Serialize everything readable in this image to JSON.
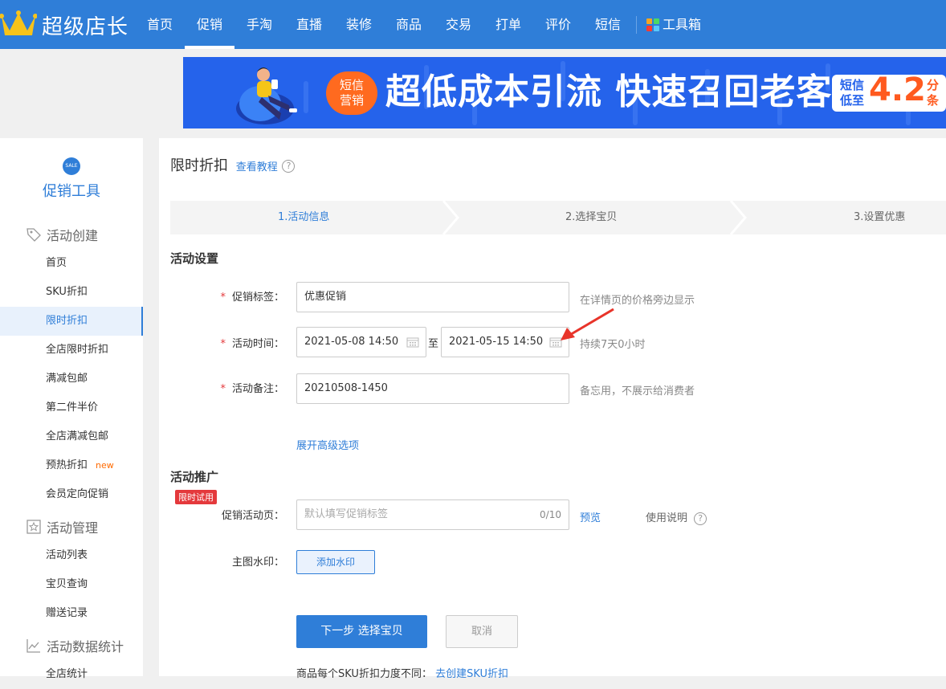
{
  "app": {
    "name": "超级店长"
  },
  "nav": {
    "items": [
      "首页",
      "促销",
      "手淘",
      "直播",
      "装修",
      "商品",
      "交易",
      "打单",
      "评价",
      "短信"
    ],
    "active": "促销",
    "toolbox": "工具箱"
  },
  "banner": {
    "badge_line1": "短信",
    "badge_line2": "营销",
    "title": "超低成本引流 快速召回老客",
    "price_label_1": "短信",
    "price_label_2": "低至",
    "price_value": "4.2",
    "price_unit_1": "分",
    "price_unit_2": "条"
  },
  "sidebar": {
    "sale_icon_text": "SALE",
    "title": "促销工具",
    "groups": [
      {
        "label": "活动创建",
        "icon": "tag-icon"
      },
      {
        "label": "活动管理",
        "icon": "star-icon"
      },
      {
        "label": "活动数据统计",
        "icon": "chart-icon"
      }
    ],
    "items": [
      "首页",
      "SKU折扣",
      "限时折扣",
      "全店限时折扣",
      "满减包邮",
      "第二件半价",
      "全店满减包邮",
      "预热折扣",
      "会员定向促销",
      "活动列表",
      "宝贝查询",
      "赠送记录",
      "全店统计"
    ],
    "active": "限时折扣",
    "new_badge": "new"
  },
  "page": {
    "title": "限时折扣",
    "tutorial_link": "查看教程",
    "help_glyph": "?"
  },
  "steps": [
    "1.活动信息",
    "2.选择宝贝",
    "3.设置优惠"
  ],
  "settings": {
    "section_title": "活动设置",
    "promo_tag": {
      "label": "促销标签：",
      "value": "优惠促销",
      "hint": "在详情页的价格旁边显示"
    },
    "time": {
      "label": "活动时间：",
      "start": "2021-05-08 14:50",
      "separator": "至",
      "end": "2021-05-15 14:50",
      "duration": "持续7天0小时"
    },
    "remark": {
      "label": "活动备注：",
      "value": "20210508-1450",
      "hint": "备忘用，不展示给消费者"
    },
    "advanced_link": "展开高级选项"
  },
  "promotion": {
    "section_title": "活动推广",
    "limited_badge": "限时试用",
    "page_label": "促销活动页：",
    "page_placeholder": "默认填写促销标签",
    "page_counter": "0/10",
    "preview_link": "预览",
    "usage_text": "使用说明",
    "watermark_label": "主图水印：",
    "watermark_button": "添加水印"
  },
  "actions": {
    "next": "下一步 选择宝贝",
    "cancel": "取消",
    "bottom_text": "商品每个SKU折扣力度不同：",
    "bottom_link": "去创建SKU折扣"
  },
  "colors": {
    "primary": "#2f7ed8",
    "banner": "#2563eb",
    "orange": "#ff6a1f",
    "required": "#e4393c"
  }
}
